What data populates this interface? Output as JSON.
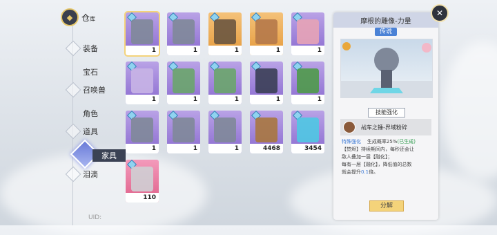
{
  "nav": {
    "warehouse_label": "仓",
    "warehouse_sub": "库",
    "items": [
      "装备",
      "宝石",
      "召唤兽",
      "角色",
      "道具",
      "家具",
      "泪滴"
    ],
    "selected_label": "家具"
  },
  "grid": {
    "items": [
      {
        "color": "purple",
        "count": "1",
        "icon": "statue-icon",
        "selected": true
      },
      {
        "color": "purple",
        "count": "1",
        "icon": "statue-icon"
      },
      {
        "color": "orange",
        "count": "1",
        "icon": "house-icon"
      },
      {
        "color": "orange",
        "count": "1",
        "icon": "shop-icon"
      },
      {
        "color": "purple",
        "count": "1",
        "icon": "pink-statue-icon"
      },
      {
        "color": "purple",
        "count": "1",
        "icon": "bunny-statue-icon"
      },
      {
        "color": "purple",
        "count": "1",
        "icon": "flower-bed-icon"
      },
      {
        "color": "purple",
        "count": "1",
        "icon": "flower-bed-icon"
      },
      {
        "color": "purple",
        "count": "1",
        "icon": "street-lamp-icon"
      },
      {
        "color": "purple",
        "count": "1",
        "icon": "tree-icon"
      },
      {
        "color": "purple",
        "count": "1",
        "icon": "statue-icon"
      },
      {
        "color": "purple",
        "count": "1",
        "icon": "statue-icon"
      },
      {
        "color": "purple",
        "count": "1",
        "icon": "statue-icon"
      },
      {
        "color": "purple",
        "count": "4468",
        "icon": "wood-logs-icon"
      },
      {
        "color": "purple",
        "count": "3454",
        "icon": "star-crystal-icon"
      },
      {
        "color": "pink",
        "count": "110",
        "icon": "ore-icon"
      }
    ]
  },
  "detail": {
    "title": "摩根的雕像-力量",
    "rarity": "传说",
    "skill_tag": "技能强化",
    "skill_name": "战车之锤-界域粉碎",
    "special_label": "特殊强化",
    "rate_text": "生成概率25%",
    "rate_status": "(已生成)",
    "desc_line1": "【焚烬】持续期间内，每秒还会让",
    "desc_line2": "敌人叠加一层【融化】；",
    "desc_line3": "每有一层【融化】，降低值的总数",
    "desc_line4_a": "就会提升",
    "desc_line4_b": "0.1",
    "desc_line4_c": "倍。",
    "decompose_label": "分解"
  },
  "uid": "UID:"
}
